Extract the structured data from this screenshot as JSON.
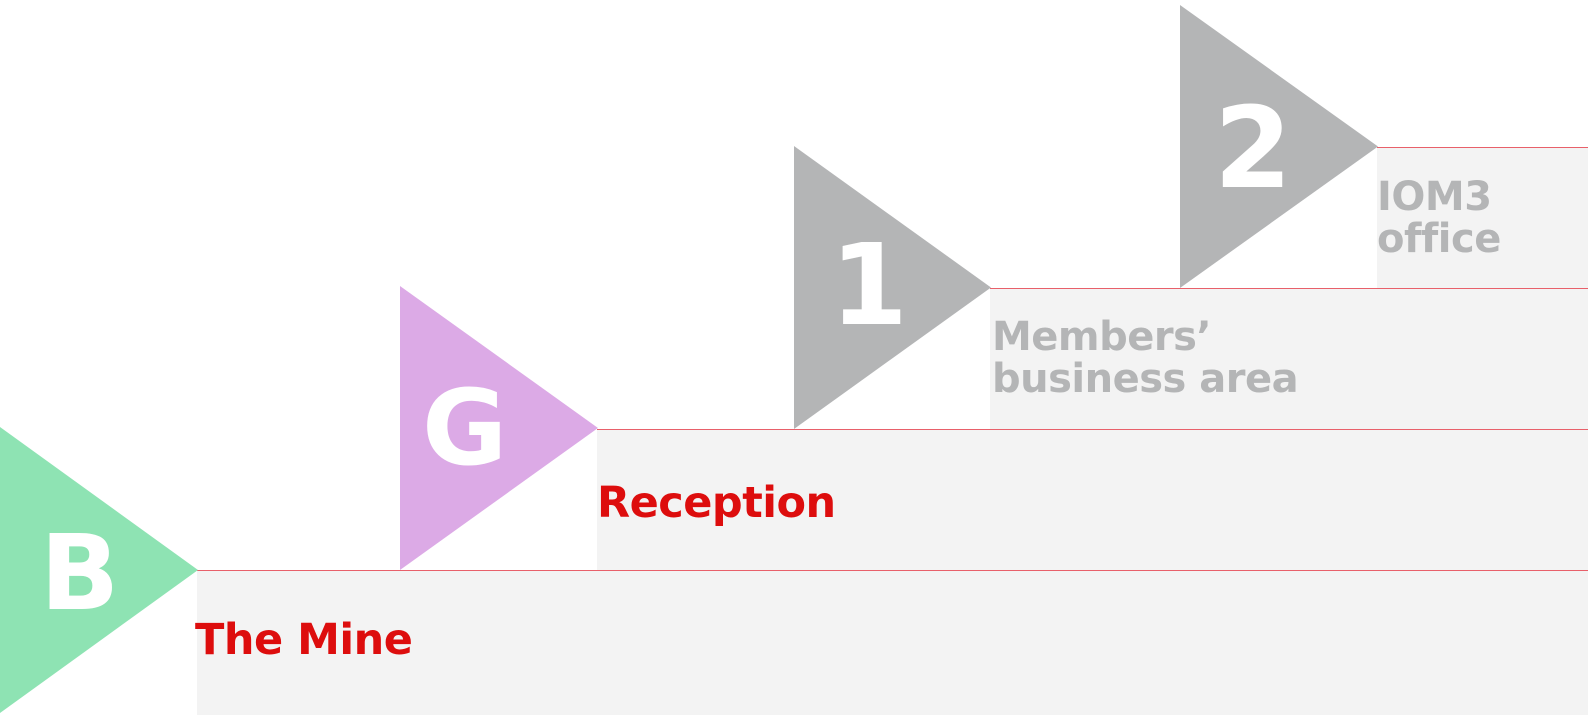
{
  "colors": {
    "band_fill": "#f3f3f3",
    "divider_line": "#e8606a",
    "active_label": "#dd0d0d",
    "muted_label": "#b4b5b6",
    "tri_basement": "#8ee3b3",
    "tri_ground": "#dcaae6",
    "tri_upper": "#b4b5b6",
    "tri_letter": "#ffffff"
  },
  "floors": [
    {
      "id": "basement",
      "marker": "B",
      "label": "The Mine",
      "state": "active",
      "triangle_color": "#8ee3b3",
      "label_color": "#dd0d0d"
    },
    {
      "id": "ground",
      "marker": "G",
      "label": "Reception",
      "state": "active",
      "triangle_color": "#dcaae6",
      "label_color": "#dd0d0d"
    },
    {
      "id": "first",
      "marker": "1",
      "label_line1": "Members’",
      "label_line2": "business area",
      "state": "muted",
      "triangle_color": "#b4b5b6",
      "label_color": "#b4b5b6"
    },
    {
      "id": "second",
      "marker": "2",
      "label_line1": "IOM3",
      "label_line2": "office",
      "state": "muted",
      "triangle_color": "#b4b5b6",
      "label_color": "#b4b5b6"
    }
  ]
}
